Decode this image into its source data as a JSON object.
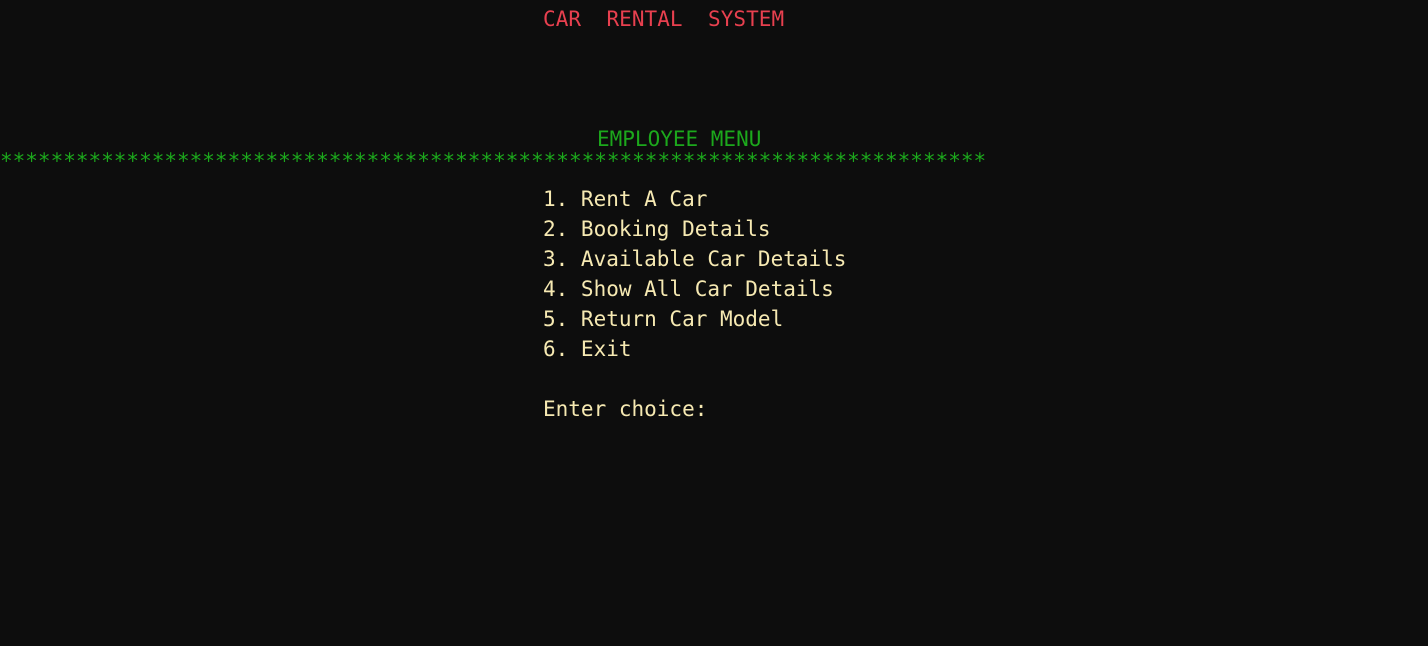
{
  "terminal": {
    "background_color": "#0d0d0d",
    "app_title": "CAR  RENTAL  SYSTEM",
    "app_title_color": "#e8404f"
  },
  "header": {
    "section_title": "EMPLOYEE MENU",
    "section_title_color": "#1ca81c",
    "separator": "******************************************************************************",
    "separator_color": "#1ca81c",
    "separator_char": "*"
  },
  "menu": {
    "text_color": "#f6e9b2",
    "items": [
      {
        "number": "1.",
        "label": "Rent A Car",
        "text": "1. Rent A Car"
      },
      {
        "number": "2.",
        "label": "Booking Details",
        "text": "2. Booking Details"
      },
      {
        "number": "3.",
        "label": "Available Car Details",
        "text": "3. Available Car Details"
      },
      {
        "number": "4.",
        "label": "Show All Car Details",
        "text": "4. Show All Car Details"
      },
      {
        "number": "5.",
        "label": "Return Car Model",
        "text": "5. Return Car Model"
      },
      {
        "number": "6.",
        "label": "Exit",
        "text": "6. Exit"
      }
    ]
  },
  "prompt": {
    "label": "Enter choice:",
    "value": "",
    "color": "#f6e9b2"
  }
}
